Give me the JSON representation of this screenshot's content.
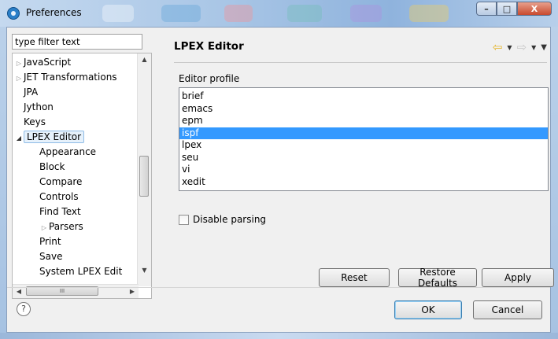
{
  "window": {
    "title": "Preferences",
    "controls": {
      "minimize": "–",
      "maximize": "□",
      "close": "X"
    }
  },
  "filter": {
    "value": "type filter text"
  },
  "tree": {
    "items": [
      {
        "label": "JavaScript",
        "level": 0,
        "twisty": "collapsed"
      },
      {
        "label": "JET Transformations",
        "level": 0,
        "twisty": "collapsed"
      },
      {
        "label": "JPA",
        "level": 0,
        "twisty": "none"
      },
      {
        "label": "Jython",
        "level": 0,
        "twisty": "none"
      },
      {
        "label": "Keys",
        "level": 0,
        "twisty": "none"
      },
      {
        "label": "LPEX Editor",
        "level": 0,
        "twisty": "expanded",
        "selected": true
      },
      {
        "label": "Appearance",
        "level": 1,
        "twisty": "none"
      },
      {
        "label": "Block",
        "level": 1,
        "twisty": "none"
      },
      {
        "label": "Compare",
        "level": 1,
        "twisty": "none"
      },
      {
        "label": "Controls",
        "level": 1,
        "twisty": "none"
      },
      {
        "label": "Find Text",
        "level": 1,
        "twisty": "none"
      },
      {
        "label": "Parsers",
        "level": 1,
        "twisty": "collapsed"
      },
      {
        "label": "Print",
        "level": 1,
        "twisty": "none"
      },
      {
        "label": "Save",
        "level": 1,
        "twisty": "none"
      },
      {
        "label": "System LPEX Edit",
        "level": 1,
        "twisty": "none"
      }
    ],
    "hscroll_grip": "III"
  },
  "page": {
    "title": "LPEX Editor",
    "section_label": "Editor profile",
    "profiles": [
      "brief",
      "emacs",
      "epm",
      "ispf",
      "lpex",
      "seu",
      "vi",
      "xedit"
    ],
    "selected_profile": "ispf",
    "disable_parsing_label": "Disable parsing",
    "disable_parsing_checked": false,
    "buttons": {
      "reset": "Reset",
      "restore_defaults": "Restore Defaults",
      "apply": "Apply"
    }
  },
  "dialog_buttons": {
    "help": "?",
    "ok": "OK",
    "cancel": "Cancel"
  },
  "colors": {
    "selection": "#3399ff",
    "back_arrow": "#e5b52a"
  }
}
